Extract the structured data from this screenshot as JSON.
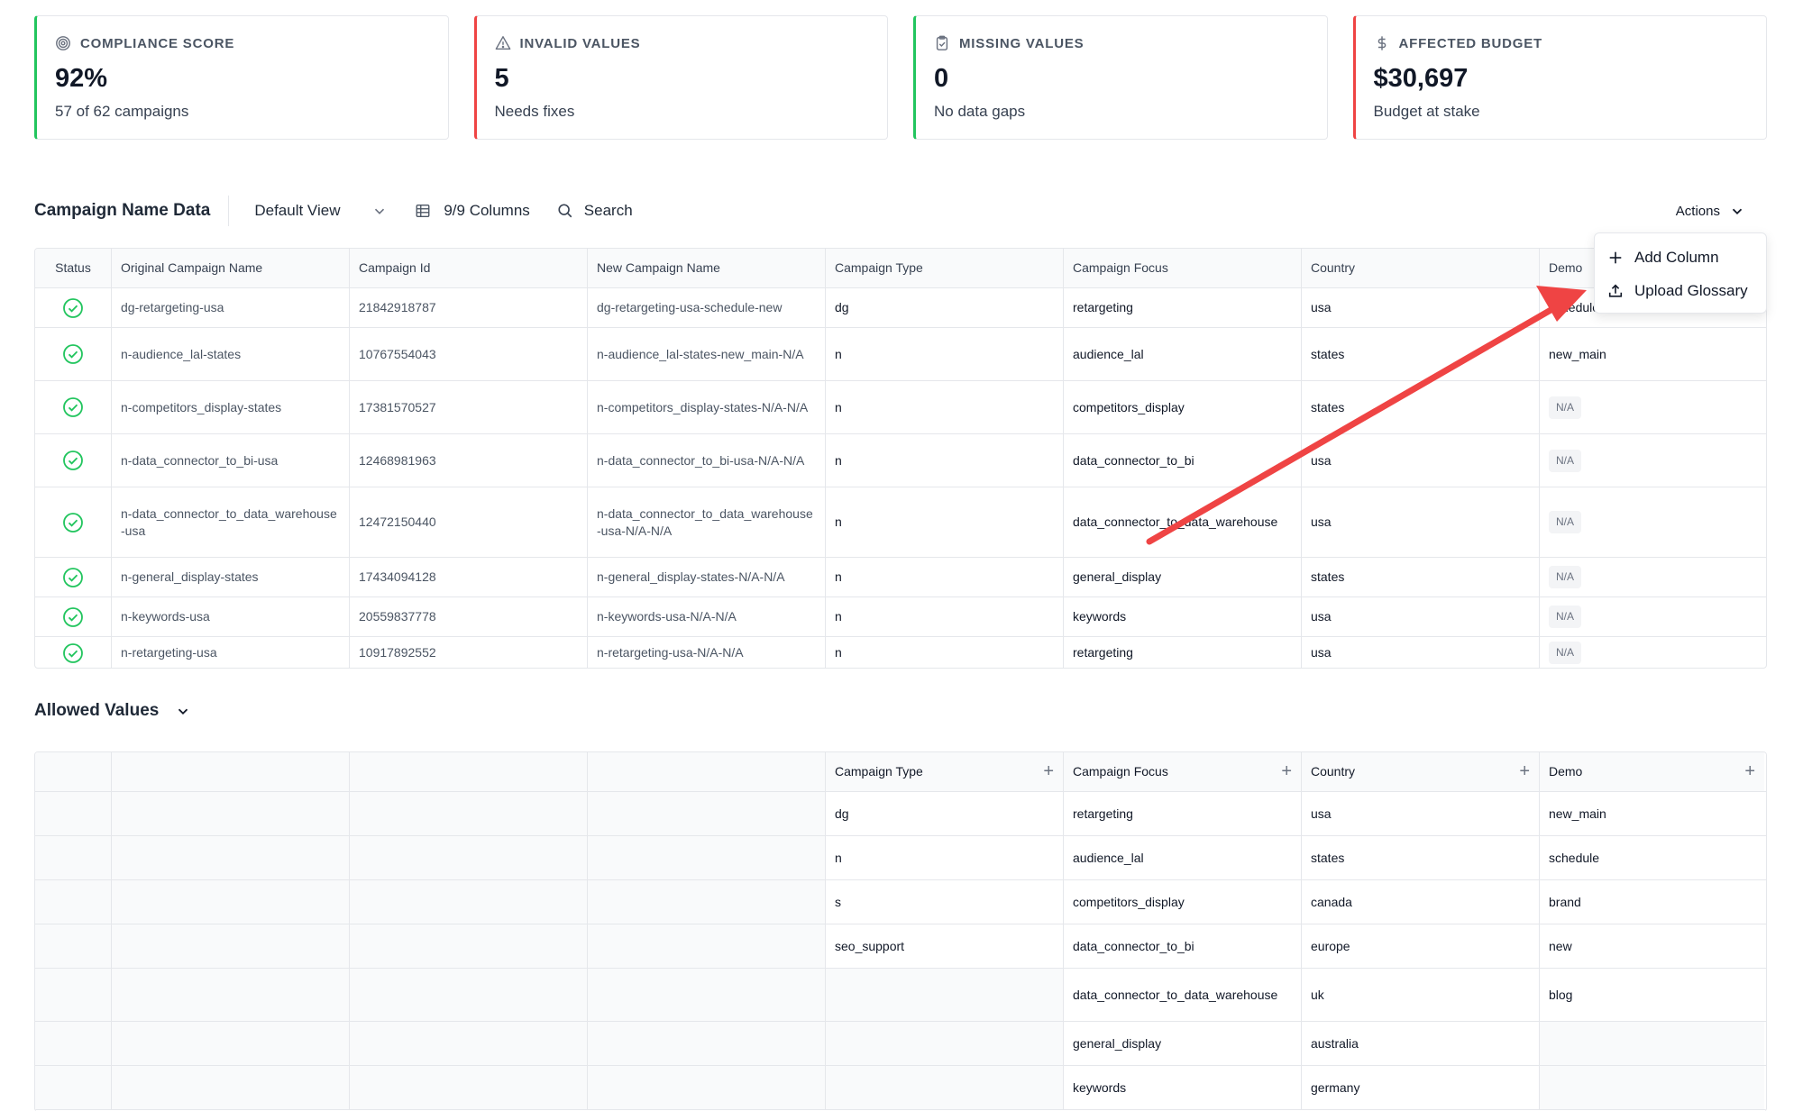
{
  "cards": [
    {
      "label": "COMPLIANCE SCORE",
      "value": "92%",
      "sub": "57 of 62 campaigns",
      "icon": "target-icon",
      "accent": "#22c55e"
    },
    {
      "label": "INVALID VALUES",
      "value": "5",
      "sub": "Needs fixes",
      "icon": "warning-icon",
      "accent": "#ef4444"
    },
    {
      "label": "MISSING VALUES",
      "value": "0",
      "sub": "No data gaps",
      "icon": "clipboard-check-icon",
      "accent": "#22c55e"
    },
    {
      "label": "AFFECTED BUDGET",
      "value": "$30,697",
      "sub": "Budget at stake",
      "icon": "dollar-icon",
      "accent": "#ef4444"
    }
  ],
  "toolbar": {
    "title": "Campaign Name Data",
    "view": "Default View",
    "columns": "9/9 Columns",
    "search": "Search",
    "actions": "Actions"
  },
  "menu": {
    "items": [
      "Add Column",
      "Upload Glossary"
    ]
  },
  "table": {
    "headers": [
      "Status",
      "Original Campaign Name",
      "Campaign Id",
      "New Campaign Name",
      "Campaign Type",
      "Campaign Focus",
      "Country",
      "Demo"
    ],
    "rows": [
      {
        "orig": "dg-retargeting-usa",
        "id": "21842918787",
        "new": "dg-retargeting-usa-schedule-new",
        "type": "dg",
        "focus": "retargeting",
        "country": "usa",
        "demo": "schedule",
        "demo_badge": false
      },
      {
        "orig": "n-audience_lal-states",
        "id": "10767554043",
        "new": "n-audience_lal-states-new_main-N/A",
        "type": "n",
        "focus": "audience_lal",
        "country": "states",
        "demo": "new_main",
        "demo_badge": false
      },
      {
        "orig": "n-competitors_display-states",
        "id": "17381570527",
        "new": "n-competitors_display-states-N/A-N/A",
        "type": "n",
        "focus": "competitors_display",
        "country": "states",
        "demo": "N/A",
        "demo_badge": true
      },
      {
        "orig": "n-data_connector_to_bi-usa",
        "id": "12468981963",
        "new": "n-data_connector_to_bi-usa-N/A-N/A",
        "type": "n",
        "focus": "data_connector_to_bi",
        "country": "usa",
        "demo": "N/A",
        "demo_badge": true
      },
      {
        "orig": "n-data_connector_to_data_warehouse-usa",
        "id": "12472150440",
        "new": "n-data_connector_to_data_warehouse-usa-N/A-N/A",
        "type": "n",
        "focus": "data_connector_to_data_warehouse",
        "country": "usa",
        "demo": "N/A",
        "demo_badge": true
      },
      {
        "orig": "n-general_display-states",
        "id": "17434094128",
        "new": "n-general_display-states-N/A-N/A",
        "type": "n",
        "focus": "general_display",
        "country": "states",
        "demo": "N/A",
        "demo_badge": true
      },
      {
        "orig": "n-keywords-usa",
        "id": "20559837778",
        "new": "n-keywords-usa-N/A-N/A",
        "type": "n",
        "focus": "keywords",
        "country": "usa",
        "demo": "N/A",
        "demo_badge": true
      },
      {
        "orig": "n-retargeting-usa",
        "id": "10917892552",
        "new": "n-retargeting-usa-N/A-N/A",
        "type": "n",
        "focus": "retargeting",
        "country": "usa",
        "demo": "N/A",
        "demo_badge": true
      }
    ]
  },
  "allowed": {
    "title": "Allowed Values",
    "headers": [
      "Campaign Type",
      "Campaign Focus",
      "Country",
      "Demo"
    ],
    "rows": [
      [
        "dg",
        "retargeting",
        "usa",
        "new_main"
      ],
      [
        "n",
        "audience_lal",
        "states",
        "schedule"
      ],
      [
        "s",
        "competitors_display",
        "canada",
        "brand"
      ],
      [
        "seo_support",
        "data_connector_to_bi",
        "europe",
        "new"
      ],
      [
        "",
        "data_connector_to_data_warehouse",
        "uk",
        "blog"
      ],
      [
        "",
        "general_display",
        "australia",
        ""
      ],
      [
        "",
        "keywords",
        "germany",
        ""
      ]
    ]
  }
}
